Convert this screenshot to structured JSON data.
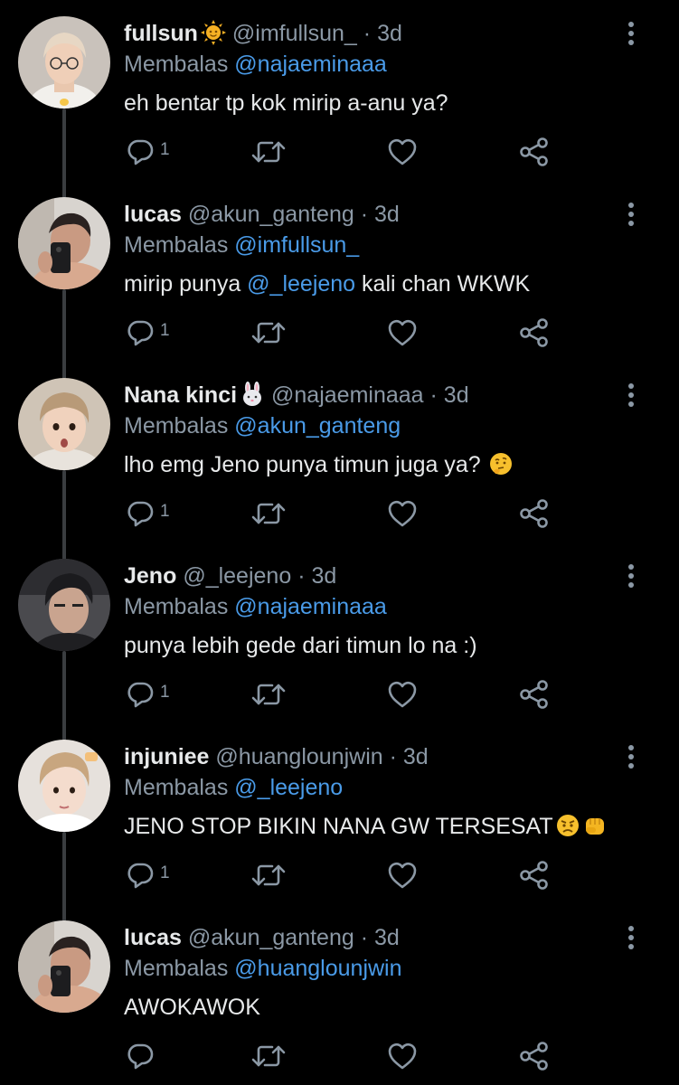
{
  "colors": {
    "background": "#000000",
    "primary_text": "#e7e9ea",
    "secondary_text": "#8b98a5",
    "mention": "#4a9be8",
    "thread_line": "#3a3d40"
  },
  "reply_prefix": "Membalas",
  "tweets": [
    {
      "name": "fullsun",
      "name_emoji": "sun-face-emoji",
      "handle": "@imfullsun_",
      "separator": "·",
      "time": "3d",
      "reply_to": "@najaeminaaa",
      "text": "eh bentar tp kok mirip a-anu ya?",
      "reply_count": "1"
    },
    {
      "name": "lucas",
      "handle": "@akun_ganteng",
      "separator": "·",
      "time": "3d",
      "reply_to": "@imfullsun_",
      "text_before": "mirip punya ",
      "text_mention": "@_leejeno",
      "text_after": " kali chan WKWK",
      "reply_count": "1"
    },
    {
      "name": "Nana kinci",
      "name_emoji": "rabbit-face-emoji",
      "handle": "@najaeminaaa",
      "separator": "·",
      "time": "3d",
      "reply_to": "@akun_ganteng",
      "text": "lho emg Jeno punya timun juga ya?",
      "text_emoji": "thinking-face-emoji",
      "reply_count": "1"
    },
    {
      "name": "Jeno",
      "handle": "@_leejeno",
      "separator": "·",
      "time": "3d",
      "reply_to": "@najaeminaaa",
      "text": "punya lebih gede dari timun lo na :)",
      "reply_count": "1"
    },
    {
      "name": "injuniee",
      "handle": "@huanglounjwin",
      "separator": "·",
      "time": "3d",
      "reply_to": "@_leejeno",
      "text": "JENO STOP BIKIN NANA GW TERSESAT",
      "text_emojis": [
        "angry-face-emoji",
        "oncoming-fist-emoji"
      ],
      "reply_count": "1"
    },
    {
      "name": "lucas",
      "handle": "@akun_ganteng",
      "separator": "·",
      "time": "3d",
      "reply_to": "@huanglounjwin",
      "text": "AWOKAWOK",
      "reply_count": ""
    }
  ],
  "icons": {
    "more": "more-vertical-icon",
    "reply": "reply-bubble-icon",
    "retweet": "retweet-icon",
    "like": "heart-icon",
    "share": "share-icon"
  }
}
